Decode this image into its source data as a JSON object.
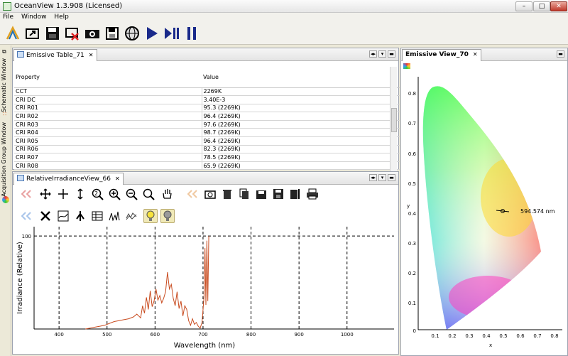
{
  "window": {
    "title": "OceanView 1.3.908 (Licensed)",
    "minimize": "–",
    "maximize": "□",
    "close": "✕"
  },
  "menu": [
    "File",
    "Window",
    "Help"
  ],
  "toolbar": {
    "icons": [
      "wizard-icon",
      "open-icon",
      "save-icon",
      "delete-icon",
      "camera-icon",
      "disk-icon",
      "globe-icon",
      "play-icon",
      "play-pause-icon",
      "pause-icon"
    ]
  },
  "left_tabs": {
    "schematic": "Schematic Window",
    "acquisition": "Acquisition Group Window"
  },
  "emissive_table": {
    "tab_label": "Emissive Table_71",
    "columns": [
      "Property",
      "Value"
    ],
    "rows": [
      [
        "CCT",
        "2269K"
      ],
      [
        "CRI DC",
        "3.40E-3"
      ],
      [
        "CRI R01",
        "95.3 (2269K)"
      ],
      [
        "CRI R02",
        "96.4 (2269K)"
      ],
      [
        "CRI R03",
        "97.6 (2269K)"
      ],
      [
        "CRI R04",
        "98.7 (2269K)"
      ],
      [
        "CRI R05",
        "96.4 (2269K)"
      ],
      [
        "CRI R06",
        "82.3 (2269K)"
      ],
      [
        "CRI R07",
        "78.5 (2269K)"
      ],
      [
        "CRI R08",
        "65.9 (2269K)"
      ]
    ]
  },
  "irradiance_view": {
    "tab_label": "RelativeIrradianceView_66",
    "x_axis_label": "Wavelength (nm)",
    "y_axis_label": "Irradiance (Relative)"
  },
  "emissive_view": {
    "tab_label": "Emissive View_70",
    "y_label": "y",
    "x_label": "x",
    "annotation": "594.574 nm",
    "y_ticks": [
      "0.8",
      "0.7",
      "0.6",
      "0.5",
      "0.4",
      "0.3",
      "0.2",
      "0.1",
      "0"
    ],
    "x_ticks": [
      "0.1",
      "0.2",
      "0.3",
      "0.4",
      "0.5",
      "0.6",
      "0.7",
      "0.8"
    ]
  },
  "chart_data": {
    "type": "line",
    "title": "",
    "xlabel": "Wavelength (nm)",
    "ylabel": "Irradiance (Relative)",
    "xlim": [
      348,
      1098
    ],
    "ylim": [
      0,
      110
    ],
    "x_ticks": [
      400,
      500,
      600,
      700,
      800,
      900,
      1000
    ],
    "y_ticks": [
      100
    ],
    "reference_line": 100,
    "grid": "dashed vertical at x ticks",
    "line_color": "#c84b1f",
    "series": [
      {
        "x": [
          455,
          465,
          475,
          485,
          495,
          505,
          515,
          525,
          535,
          545,
          555,
          562,
          566,
          570,
          574,
          578,
          582,
          586,
          590,
          594,
          598,
          602,
          606,
          610,
          614,
          618,
          622,
          626,
          630,
          634,
          638,
          642,
          646,
          650,
          654,
          658,
          662,
          666,
          670,
          674,
          678,
          682,
          686,
          690,
          694,
          698,
          702,
          704,
          706,
          708,
          710,
          712
        ],
        "y": [
          0,
          1,
          2,
          3,
          4,
          6,
          8,
          9,
          10,
          11,
          13,
          16,
          14,
          12,
          25,
          17,
          34,
          21,
          41,
          24,
          30,
          43,
          31,
          36,
          28,
          33,
          40,
          61,
          43,
          48,
          33,
          25,
          40,
          22,
          30,
          14,
          25,
          21,
          9,
          4,
          11,
          5,
          7,
          3,
          1,
          7,
          34,
          87,
          26,
          95,
          30,
          100
        ]
      }
    ]
  }
}
